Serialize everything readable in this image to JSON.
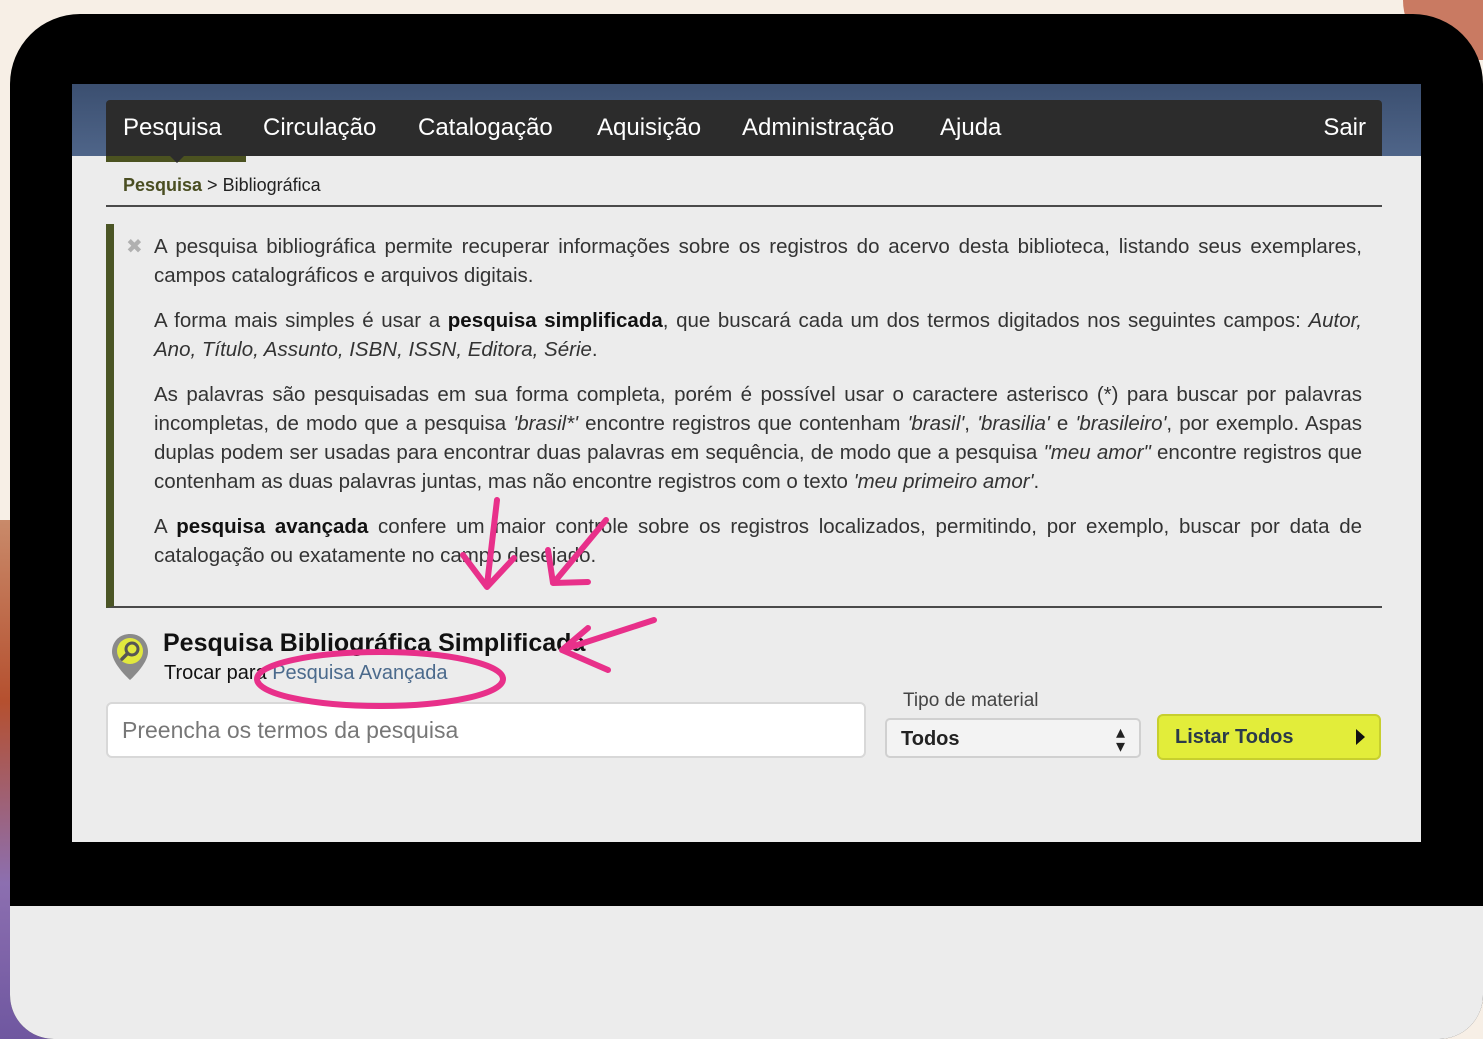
{
  "nav": {
    "items": [
      {
        "label": "Pesquisa"
      },
      {
        "label": "Circulação"
      },
      {
        "label": "Catalogação"
      },
      {
        "label": "Aquisição"
      },
      {
        "label": "Administração"
      },
      {
        "label": "Ajuda"
      }
    ],
    "logout_label": "Sair"
  },
  "breadcrumb": {
    "root": "Pesquisa",
    "separator": ">",
    "current": "Bibliográfica"
  },
  "info": {
    "close_icon": "close-icon",
    "p1": "A pesquisa bibliográfica permite recuperar informações sobre os registros do acervo desta biblioteca, listando seus exemplares, campos catalográficos e arquivos digitais.",
    "p2_a": "A forma mais simples é usar a ",
    "p2_b": "pesquisa simplificada",
    "p2_c": ", que buscará cada um dos termos digitados nos seguintes campos: ",
    "p2_d": "Autor, Ano, Título, Assunto, ISBN, ISSN, Editora, Série",
    "p2_e": ".",
    "p3_a": "As palavras são pesquisadas em sua forma completa, porém é possível usar o caractere asterisco (*) para buscar por palavras incompletas, de modo que a pesquisa ",
    "p3_b": "'brasil*'",
    "p3_c": " encontre registros que contenham ",
    "p3_d": "'brasil'",
    "p3_e": ", ",
    "p3_f": "'brasilia'",
    "p3_g": " e ",
    "p3_h": "'brasileiro'",
    "p3_i": ", por exemplo. Aspas duplas podem ser usadas para encontrar duas palavras em sequência, de modo que a pesquisa ",
    "p3_j": "\"meu amor\"",
    "p3_k": " encontre registros que contenham as duas palavras juntas, mas não encontre registros com o texto ",
    "p3_l": "'meu primeiro amor'",
    "p3_m": ".",
    "p4_a": "A ",
    "p4_b": "pesquisa avançada",
    "p4_c": " confere um maior controle sobre os registros localizados, permitindo, por exemplo, buscar por data de catalogação ou exatamente no campo desejado."
  },
  "search": {
    "icon": "search-pin-icon",
    "title": "Pesquisa Bibliográfica Simplificada",
    "switch_prefix": "Trocar para ",
    "switch_link": "Pesquisa Avançada",
    "placeholder": "Preencha os termos da pesquisa",
    "material_label": "Tipo de material",
    "material_value": "Todos",
    "list_all_label": "Listar Todos"
  },
  "colors": {
    "menubar": "#2c2c2c",
    "accent_olive": "#4b5525",
    "list_all_button": "#e2ed3a",
    "link": "#4b6a8c",
    "annotation_pink": "#e8308a"
  }
}
